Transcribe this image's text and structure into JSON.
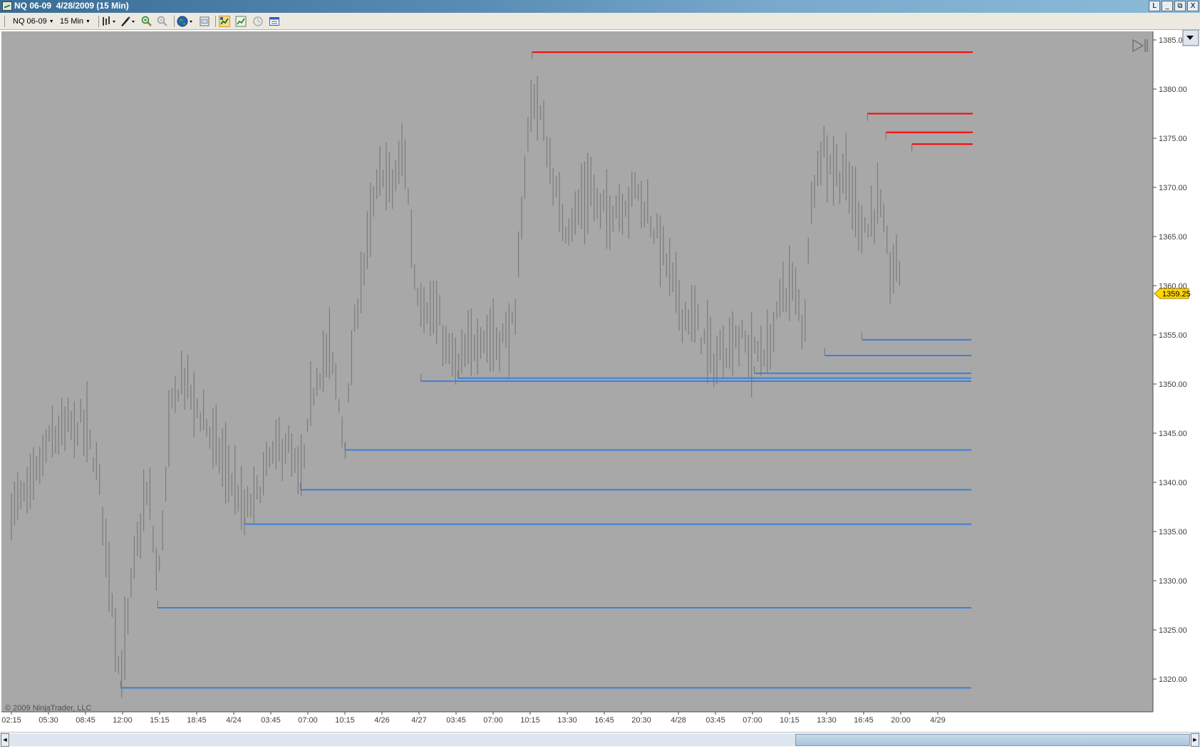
{
  "window": {
    "title": "NQ 06-09  4/28/2009 (15 Min)",
    "buttons": [
      "L",
      "_",
      "⧉",
      "X"
    ]
  },
  "toolbar": {
    "instrument": "NQ 06-09",
    "interval": "15 Min",
    "icons": [
      "bar-style-icon",
      "drawing-tool-icon",
      "zoom-in-icon",
      "zoom-out-icon",
      "globe-icon",
      "properties-icon",
      "strategy-icon",
      "indicator-icon",
      "clock-icon",
      "data-box-icon"
    ]
  },
  "chart": {
    "copyright": "© 2009 NinjaTrader, LLC",
    "current_price_label": "1359.25",
    "current_price": 1359.25,
    "background": "#a8a8a8",
    "colors": {
      "bar": "#7b7b7b",
      "resistance": "#ff0000",
      "support": "#3d7fd6",
      "price_tag": "#ffd700"
    }
  },
  "chart_data": {
    "type": "ohlc-bar",
    "instrument": "NQ 06-09",
    "interval": "15 Min",
    "ylim": [
      1317.5,
      1386.0
    ],
    "y_ticks": [
      "1385.00",
      "1380.00",
      "1375.00",
      "1370.00",
      "1365.00",
      "1360.00",
      "1355.00",
      "1350.00",
      "1345.00",
      "1340.00",
      "1335.00",
      "1330.00",
      "1325.00",
      "1320.00"
    ],
    "x_ticks": [
      "02:15",
      "05:30",
      "08:45",
      "12:00",
      "15:15",
      "18:45",
      "4/24",
      "03:45",
      "07:00",
      "10:15",
      "4/26",
      "4/27",
      "03:45",
      "07:00",
      "10:15",
      "13:30",
      "16:45",
      "20:30",
      "4/28",
      "03:45",
      "07:00",
      "10:15",
      "13:30",
      "16:45",
      "20:00",
      "4/29"
    ],
    "resistance_levels": [
      {
        "price": 1383.75,
        "start_tick": 14.05
      },
      {
        "price": 1377.5,
        "start_tick": 23.1
      },
      {
        "price": 1375.6,
        "start_tick": 23.6
      },
      {
        "price": 1374.4,
        "start_tick": 24.3
      }
    ],
    "support_levels": [
      {
        "price": 1354.5,
        "start_tick": 22.95
      },
      {
        "price": 1352.9,
        "start_tick": 21.95
      },
      {
        "price": 1351.1,
        "start_tick": 20.05
      },
      {
        "price": 1350.6,
        "start_tick": 12.05
      },
      {
        "price": 1350.3,
        "start_tick": 11.05
      },
      {
        "price": 1343.3,
        "start_tick": 9.0
      },
      {
        "price": 1339.25,
        "start_tick": 7.8
      },
      {
        "price": 1335.75,
        "start_tick": 6.3
      },
      {
        "price": 1327.25,
        "start_tick": 3.95
      },
      {
        "price": 1319.1,
        "start_tick": 2.95
      }
    ],
    "price_path": [
      [
        0,
        1337.5
      ],
      [
        0.5,
        1339.0
      ],
      [
        1.0,
        1344.0
      ],
      [
        1.5,
        1345.5
      ],
      [
        2.0,
        1346.0
      ],
      [
        2.4,
        1339.5
      ],
      [
        2.7,
        1329.0
      ],
      [
        2.95,
        1319.5
      ],
      [
        3.3,
        1331.5
      ],
      [
        3.7,
        1339.5
      ],
      [
        3.95,
        1329.0
      ],
      [
        4.3,
        1347.0
      ],
      [
        4.6,
        1351.0
      ],
      [
        4.85,
        1349.0
      ],
      [
        5.3,
        1345.5
      ],
      [
        5.8,
        1341.5
      ],
      [
        6.0,
        1340.0
      ],
      [
        6.3,
        1336.5
      ],
      [
        6.7,
        1339.5
      ],
      [
        7.0,
        1342.5
      ],
      [
        7.4,
        1344.0
      ],
      [
        7.8,
        1339.8
      ],
      [
        8.2,
        1350.5
      ],
      [
        8.6,
        1353.5
      ],
      [
        9.0,
        1344.0
      ],
      [
        9.3,
        1357.0
      ],
      [
        9.7,
        1366.5
      ],
      [
        10.0,
        1372.0
      ],
      [
        10.3,
        1370.0
      ],
      [
        10.6,
        1374.0
      ],
      [
        10.9,
        1360.0
      ],
      [
        11.2,
        1358.0
      ],
      [
        11.5,
        1356.5
      ],
      [
        11.8,
        1353.0
      ],
      [
        12.05,
        1351.5
      ],
      [
        12.6,
        1355.0
      ],
      [
        13.2,
        1354.5
      ],
      [
        13.6,
        1356.0
      ],
      [
        13.8,
        1369.0
      ],
      [
        14.05,
        1380.0
      ],
      [
        14.3,
        1377.0
      ],
      [
        14.6,
        1371.0
      ],
      [
        14.9,
        1366.0
      ],
      [
        15.2,
        1367.0
      ],
      [
        15.6,
        1370.0
      ],
      [
        15.9,
        1367.5
      ],
      [
        16.3,
        1368.0
      ],
      [
        16.6,
        1368.5
      ],
      [
        16.9,
        1370.0
      ],
      [
        17.2,
        1367.0
      ],
      [
        17.5,
        1364.5
      ],
      [
        17.8,
        1361.0
      ],
      [
        18.1,
        1357.5
      ],
      [
        18.4,
        1356.5
      ],
      [
        18.7,
        1354.5
      ],
      [
        19.0,
        1352.0
      ],
      [
        19.3,
        1354.0
      ],
      [
        19.6,
        1355.0
      ],
      [
        19.9,
        1353.5
      ],
      [
        20.2,
        1353.0
      ],
      [
        20.5,
        1354.0
      ],
      [
        20.8,
        1359.5
      ],
      [
        21.1,
        1360.0
      ],
      [
        21.4,
        1355.5
      ],
      [
        21.6,
        1370.0
      ],
      [
        21.9,
        1374.0
      ],
      [
        22.2,
        1372.0
      ],
      [
        22.5,
        1371.0
      ],
      [
        22.8,
        1368.0
      ],
      [
        23.1,
        1365.5
      ],
      [
        23.4,
        1369.0
      ],
      [
        23.7,
        1361.5
      ],
      [
        24.0,
        1362.0
      ]
    ]
  },
  "scrollbar": {
    "left_arrow": "◄",
    "right_arrow": "►"
  }
}
